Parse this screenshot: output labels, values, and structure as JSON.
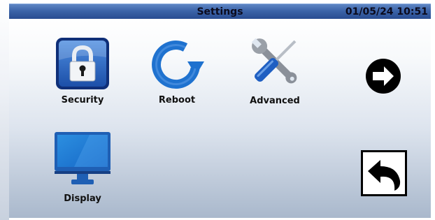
{
  "header": {
    "title": "Settings",
    "datetime": "01/05/24 10:51"
  },
  "tiles": [
    {
      "label": "Security",
      "icon": "padlock-icon"
    },
    {
      "label": "Reboot",
      "icon": "reboot-icon"
    },
    {
      "label": "Advanced",
      "icon": "wrench-screwdriver-icon"
    },
    {
      "label": "Display",
      "icon": "monitor-icon"
    }
  ],
  "navigation": {
    "next_icon": "arrow-right-icon",
    "back_icon": "back-arrow-icon"
  },
  "colors": {
    "header_blue": "#3b63a8",
    "icon_blue": "#1f6fcc",
    "panel_gradient_end": "#a9b8cc"
  }
}
